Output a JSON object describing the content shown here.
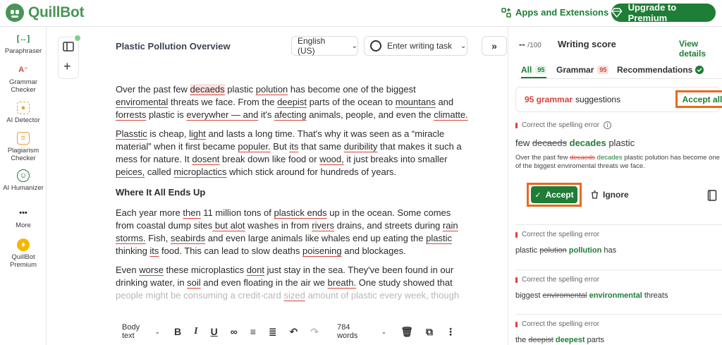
{
  "brand": {
    "name": "QuillBot",
    "color": "#499557",
    "accent": "#1e7d36"
  },
  "header": {
    "apps_label": "Apps and Extensions",
    "upgrade_label": "Upgrade to Premium"
  },
  "sidebar": {
    "items": [
      {
        "label": "Paraphraser",
        "icon": "paraphraser-icon",
        "color": "#1e7d36"
      },
      {
        "label": "Grammar Checker",
        "icon": "grammar-checker-icon",
        "color": "#d9433a"
      },
      {
        "label": "AI Detector",
        "icon": "ai-detector-icon",
        "color": "#e6a23c"
      },
      {
        "label": "Plagiarism Checker",
        "icon": "plagiarism-checker-icon",
        "color": "#e6a23c"
      },
      {
        "label": "AI Humanizer",
        "icon": "ai-humanizer-icon",
        "color": "#1e7d36"
      },
      {
        "label": "More",
        "icon": "more-icon",
        "color": "#333333"
      },
      {
        "label": "QuillBot Premium",
        "icon": "premium-icon",
        "color": "#f5b800"
      }
    ]
  },
  "document": {
    "title": "Plastic Pollution Overview",
    "language": "English (US)",
    "task_placeholder": "Enter writing task",
    "word_count": "784 words",
    "text_style": "Body text"
  },
  "editor": {
    "p1": {
      "a": "Over the past few ",
      "b": "decaeds",
      "c": " plastic ",
      "d": "polution",
      "e": " has become one of the biggest ",
      "f": "enviromental",
      "g": " threats we face. From the ",
      "h": "deepist",
      "i": " parts of the ocean to ",
      "j": "mountans",
      "k": " and ",
      "l": "forrests",
      "m": " plastic is ",
      "n": "everywher — and",
      "o": " it's ",
      "p": "afecting",
      "q": " animals, people, and even the ",
      "r": "climatte."
    },
    "p2": {
      "a": "Plasstic",
      "b": " is cheap, ",
      "c": "light",
      "d": " and lasts a long time. That's why it was seen as a “miracle material” when it first became ",
      "e": "populer.",
      "f": " But ",
      "g": "its",
      "h": " that same ",
      "i": "duribility",
      "j": " that makes it such a mess for nature. It ",
      "k": "dosent",
      "l": " break down like food or ",
      "m": "wood,",
      "n": " it just breaks into smaller ",
      "o": "peices,",
      "p": " called ",
      "q": "microplactics",
      "r": " which stick around for hundreds of years."
    },
    "heading": "Where It All Ends Up",
    "p3": {
      "a": "Each year more ",
      "b": "then",
      "c": " 11 million tons of ",
      "d": "plastick ends",
      "e": " up in the ocean. Some comes from coastal dump sites",
      "f": " but alot",
      "g": " washes in from ",
      "h": "rivers",
      "i": " drains, and streets during ",
      "j": "rain storms.",
      "k": " Fish, ",
      "l": "seabirds",
      "m": " and even large animals like whales end up eating the ",
      "n": "plastic",
      "o": " thinking ",
      "p": "its",
      "q": " food. This can lead to slow deaths ",
      "r": "poisening",
      "s": " and blockages."
    },
    "p4": {
      "a": "Even ",
      "b": "worse",
      "c": " these microplastics ",
      "d": "dont",
      "e": " just stay in the sea. They've been found in our drinking water, in ",
      "f": "soil",
      "g": " and even floating in the air we ",
      "h": "breath.",
      "i": " One study showed that ",
      "j": "people might be consuming a credit-card ",
      "k": "sized",
      "l": " amount of plastic every week, though"
    }
  },
  "panel": {
    "score": "--",
    "score_max": "/100",
    "score_label": "Writing score",
    "view_details": "View details",
    "tabs": [
      {
        "label": "All",
        "count": "95"
      },
      {
        "label": "Grammar",
        "count": "95"
      },
      {
        "label": "Recommendations"
      }
    ],
    "suggestions_count": "95 grammar",
    "suggestions_label": "suggestions",
    "accept_all": "Accept all",
    "main_card": {
      "type": "Correct the spelling error",
      "before": "few",
      "wrong": "decaeds",
      "right": "decades",
      "after": "plastic",
      "context_a": "Over the past few ",
      "context_wrong": "decaeds",
      "context_right": "decades",
      "context_b": " plastic polution has become one of the biggest enviromental threats we face.",
      "accept": "Accept",
      "ignore": "Ignore"
    },
    "cards": [
      {
        "type": "Correct the spelling error",
        "before": "plastic",
        "wrong": "polution",
        "right": "pollution",
        "after": "has"
      },
      {
        "type": "Correct the spelling error",
        "before": "biggest",
        "wrong": "enviromental",
        "right": "environmental",
        "after": "threats"
      },
      {
        "type": "Correct the spelling error",
        "before": "the",
        "wrong": "deepist",
        "right": "deepest",
        "after": "parts"
      }
    ]
  }
}
